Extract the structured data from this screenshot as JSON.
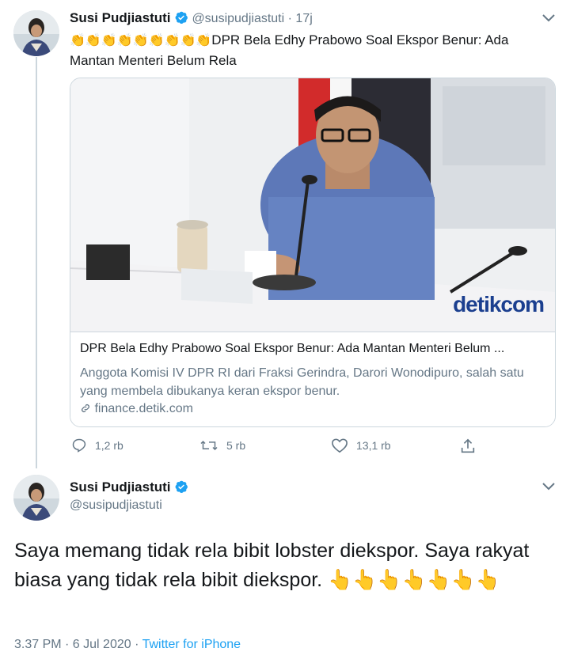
{
  "tweet1": {
    "name": "Susi Pudjiastuti",
    "handle": "@susipudjiastuti",
    "sep": "·",
    "time": "17j",
    "emoji": "👏👏👏👏👏👏👏👏👏",
    "text_line1": "DPR Bela Edhy Prabowo Soal Ekspor Benur: Ada",
    "text_line2": "Mantan Menteri Belum Rela",
    "card": {
      "image_watermark": "detikcom",
      "title": "DPR Bela Edhy Prabowo Soal Ekspor Benur: Ada Mantan Menteri Belum ...",
      "description": "Anggota Komisi IV DPR RI dari Fraksi Gerindra, Darori Wonodipuro, salah satu yang membela dibukanya keran ekspor benur.",
      "domain": "finance.detik.com"
    },
    "actions": {
      "reply_count": "1,2 rb",
      "retweet_count": "5 rb",
      "like_count": "13,1 rb"
    }
  },
  "tweet2": {
    "name": "Susi Pudjiastuti",
    "handle": "@susipudjiastuti",
    "text": "Saya memang tidak rela bibit lobster diekspor. Saya rakyat biasa yang tidak rela bibit diekspor. 👆👆👆👆👆👆👆",
    "timestamp": "3.37 PM · 6 Jul 2020 · ",
    "source": "Twitter for iPhone"
  },
  "colors": {
    "accent": "#1da1f2",
    "text": "#14171a",
    "muted": "#657786",
    "border": "#ccd6dd"
  },
  "icons": [
    "verified-badge-icon",
    "chevron-down-icon",
    "reply-icon",
    "retweet-icon",
    "like-icon",
    "share-icon",
    "link-icon"
  ]
}
